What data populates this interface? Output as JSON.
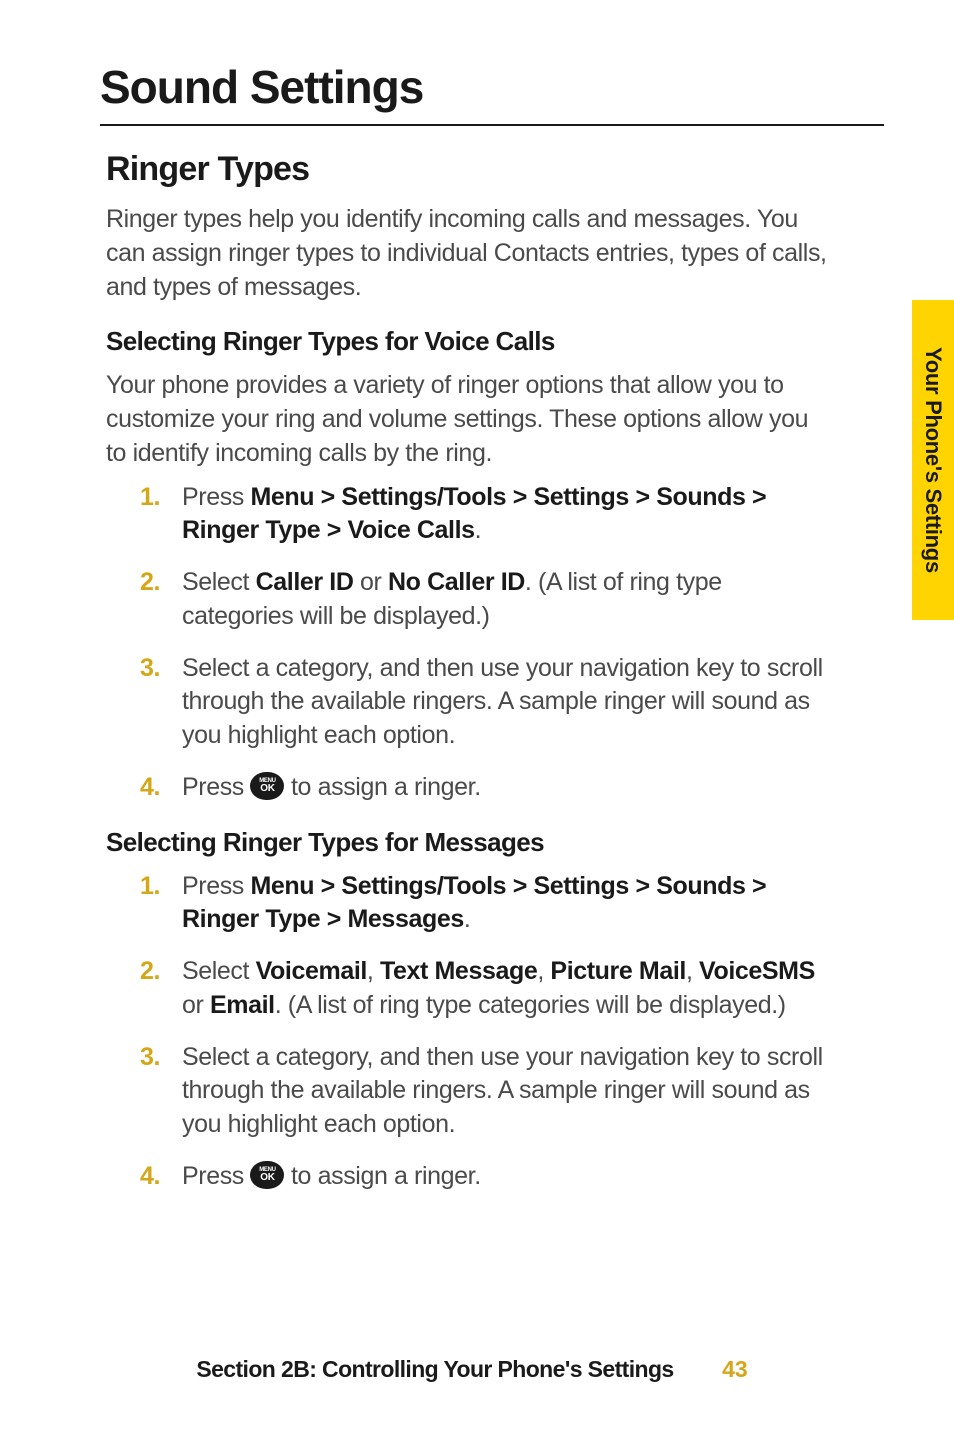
{
  "side_tab": "Your Phone's Settings",
  "h1": "Sound Settings",
  "h2": "Ringer Types",
  "intro": "Ringer types help you identify incoming calls and messages. You can assign ringer types to individual Contacts entries, types of calls, and types of messages.",
  "sec1_h3": "Selecting Ringer Types for Voice Calls",
  "sec1_para": "Your phone provides a variety of ringer options that allow you to customize your ring and volume settings. These options allow you to identify incoming calls by the ring.",
  "sec1_items": {
    "n1": "1.",
    "t1a": "Press ",
    "t1b": "Menu > Settings/Tools > Settings > Sounds > Ringer Type > Voice Calls",
    "t1c": ".",
    "n2": "2.",
    "t2a": "Select ",
    "t2b": "Caller ID",
    "t2c": " or ",
    "t2d": "No Caller ID",
    "t2e": ". (A list of ring type categories will be displayed.)",
    "n3": "3.",
    "t3": "Select a category, and then use your navigation key to scroll through the available ringers. A sample ringer will sound as you highlight each option.",
    "n4": "4.",
    "t4a": "Press ",
    "t4b": " to assign a ringer."
  },
  "sec2_h3": "Selecting Ringer Types for Messages",
  "sec2_items": {
    "n1": "1.",
    "t1a": "Press ",
    "t1b": "Menu > Settings/Tools > Settings > Sounds > Ringer Type > Messages",
    "t1c": ".",
    "n2": "2.",
    "t2a": "Select ",
    "t2b": "Voicemail",
    "t2c": ", ",
    "t2d": "Text Message",
    "t2e": ", ",
    "t2f": "Picture Mail",
    "t2g": ", ",
    "t2h": "VoiceSMS",
    "t2i": " or ",
    "t2j": "Email",
    "t2k": ". (A list of ring type categories will be displayed.)",
    "n3": "3.",
    "t3": "Select a category, and then use your navigation key to scroll through the available ringers. A sample ringer will sound as you highlight each option.",
    "n4": "4.",
    "t4a": "Press ",
    "t4b": " to assign a ringer."
  },
  "icon": {
    "top": "MENU",
    "bottom": "OK"
  },
  "footer": {
    "title": "Section 2B: Controlling Your Phone's Settings",
    "page": "43"
  }
}
